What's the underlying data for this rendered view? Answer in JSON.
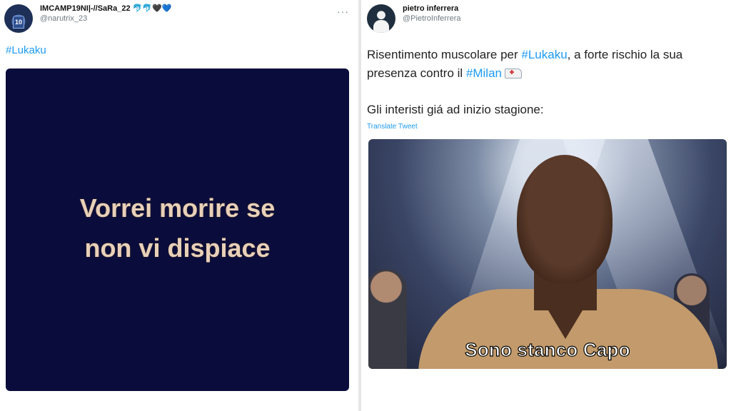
{
  "left_tweet": {
    "display_name": "IMCAMP19NI|-//SaRa_22 🐬🐬🖤💙",
    "handle": "@narutrix_23",
    "more": "···",
    "hashtag": "#Lukaku",
    "media_caption_line1": "Vorrei morire se",
    "media_caption_line2": "non vi dispiace"
  },
  "right_tweet": {
    "display_name": "pietro inferrera",
    "handle": "@PietroInferrera",
    "text_part1": "Risentimento muscolare per ",
    "text_hashtag1": "#Lukaku",
    "text_part2": ", a forte rischio la sua presenza contro il ",
    "text_hashtag2": "#Milan",
    "text_emoji": "ambulance",
    "paragraph2": "Gli interisti giá ad inizio stagione:",
    "translate": "Translate Tweet",
    "media_caption": "Sono stanco Capo"
  },
  "colors": {
    "link": "#1d9bf0",
    "left_media_bg": "#0a0c3c",
    "left_caption": "#e8d0b8"
  }
}
